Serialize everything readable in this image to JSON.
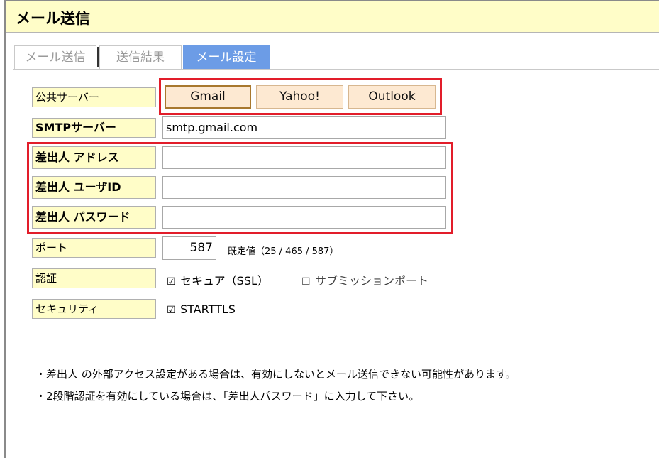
{
  "window": {
    "title": "メール送信"
  },
  "tabs": [
    {
      "label": "メール送信",
      "active": false
    },
    {
      "label": "送信結果",
      "active": false
    },
    {
      "label": "メール設定",
      "active": true
    }
  ],
  "settings": {
    "public_server": {
      "label": "公共サーバー",
      "buttons": [
        {
          "label": "Gmail",
          "selected": true
        },
        {
          "label": "Yahoo!",
          "selected": false
        },
        {
          "label": "Outlook",
          "selected": false
        }
      ]
    },
    "smtp": {
      "label": "SMTPサーバー",
      "value": "smtp.gmail.com"
    },
    "sender_address": {
      "label": "差出人 アドレス",
      "value": ""
    },
    "sender_user_id": {
      "label": "差出人 ユーザID",
      "value": ""
    },
    "sender_password": {
      "label": "差出人 パスワード",
      "value": ""
    },
    "port": {
      "label": "ポート",
      "value": "587",
      "hint": "既定値（25 / 465 / 587）"
    },
    "auth": {
      "label": "認証",
      "secure_ssl": {
        "label": "セキュア（SSL）",
        "checked": true
      },
      "submission_port": {
        "label": "サブミッションポート",
        "checked": false
      }
    },
    "security": {
      "label": "セキュリティ",
      "starttls": {
        "label": "STARTTLS",
        "checked": true
      }
    }
  },
  "icons": {
    "checked": "checkbox-checked-icon",
    "unchecked": "checkbox-unchecked-icon"
  },
  "colors": {
    "label_bg": "#fffdc8",
    "active_tab": "#6c9ce6",
    "highlight": "#e21d2a",
    "button_bg": "#fde9d2"
  },
  "notes": [
    "・差出人 の外部アクセス設定がある場合は、有効にしないとメール送信できない可能性があります。",
    "・2段階認証を有効にしている場合は、「差出人パスワード」に入力して下さい。"
  ]
}
